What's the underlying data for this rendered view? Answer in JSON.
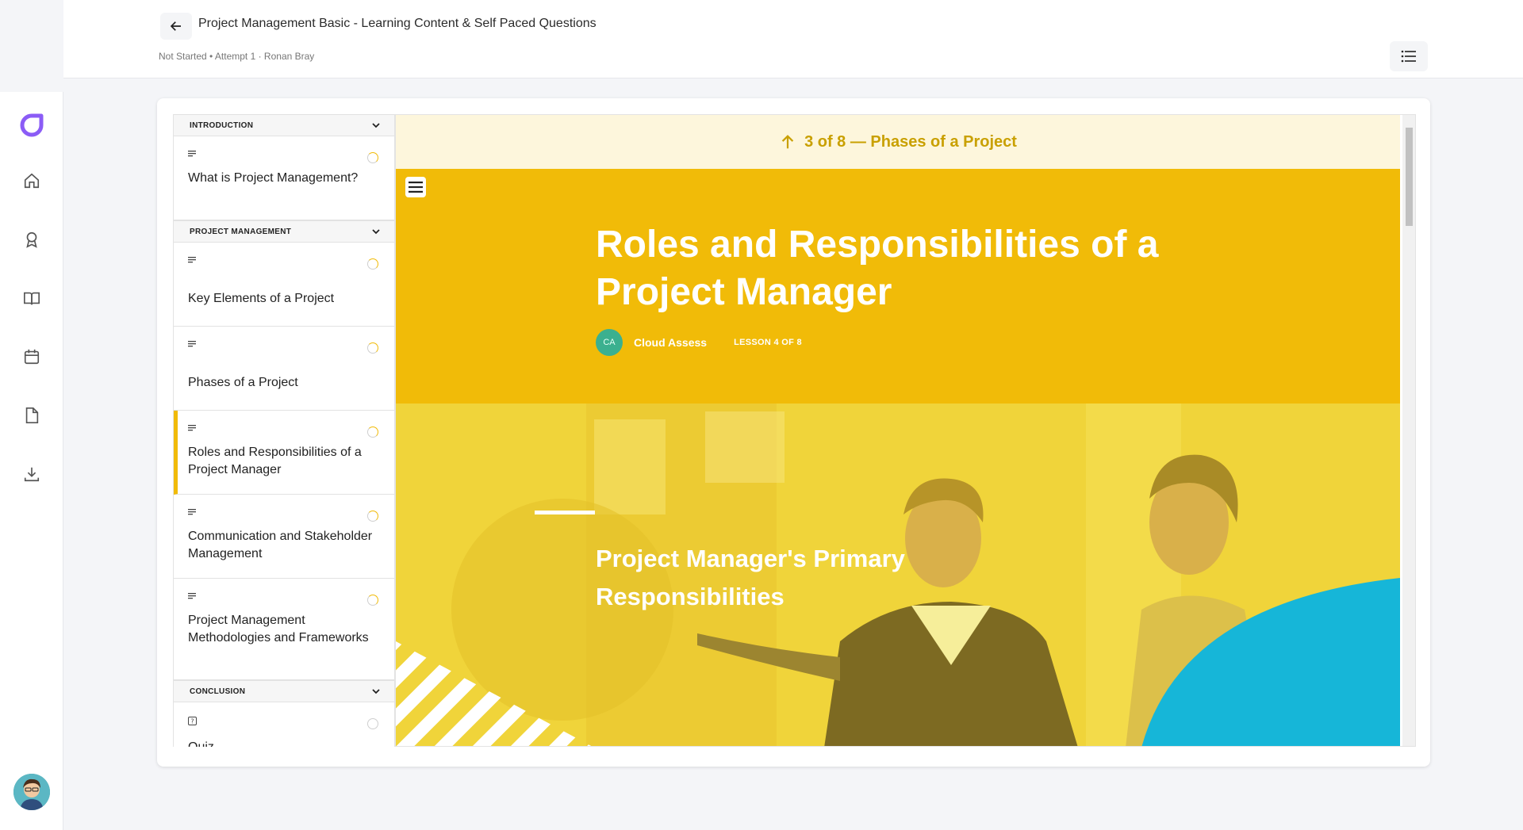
{
  "header": {
    "title": "Project Management Basic - Learning Content & Self Paced Questions",
    "subtitle": "Not Started • Attempt 1 · Ronan Bray"
  },
  "rail": {
    "icons": [
      "logo-icon",
      "home-icon",
      "award-icon",
      "book-icon",
      "calendar-icon",
      "document-icon",
      "download-icon"
    ]
  },
  "outline": {
    "sections": [
      {
        "title": "INTRODUCTION",
        "lessons": [
          {
            "type_icon": "text-lines-icon",
            "title": "What is Project Management?"
          }
        ]
      },
      {
        "title": "PROJECT MANAGEMENT",
        "lessons": [
          {
            "type_icon": "text-lines-icon",
            "title": "Key Elements of a Project"
          },
          {
            "type_icon": "text-lines-icon",
            "title": "Phases of a Project"
          },
          {
            "type_icon": "text-lines-icon",
            "title": "Roles and Responsibilities of a Project Manager"
          },
          {
            "type_icon": "text-lines-icon",
            "title": "Communication and Stakeholder Management"
          },
          {
            "type_icon": "text-lines-icon",
            "title": "Project Management Methodologies and Frameworks"
          }
        ]
      },
      {
        "title": "CONCLUSION",
        "lessons": [
          {
            "type_icon": "quiz-icon",
            "title": "Quiz"
          }
        ]
      }
    ]
  },
  "content": {
    "prev_banner": "3 of 8 — Phases of a Project",
    "lesson_title": "Roles and Responsibilities of a Project Manager",
    "author_initials": "CA",
    "author": "Cloud Assess",
    "lesson_counter": "LESSON 4 OF 8",
    "section_heading": "Project Manager's Primary Responsibilities"
  },
  "colors": {
    "accent": "#f1bb08",
    "banner_bg": "#fdf6dc",
    "banner_text": "#c9a000",
    "logo": "#8b5cf6",
    "blob": "#16b6d8"
  }
}
